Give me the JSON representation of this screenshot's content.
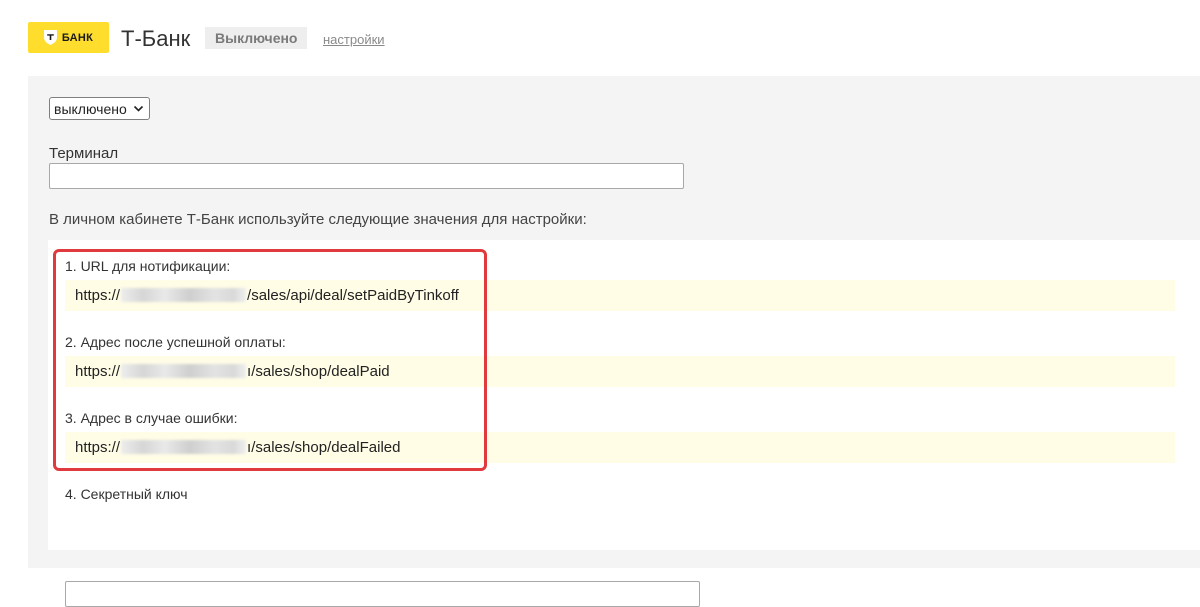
{
  "header": {
    "logo_text": "БАНК",
    "logo_color": "#ffdd2d",
    "app_title": "Т-Банк",
    "status_badge": "Выключено",
    "settings_link": "настройки"
  },
  "form": {
    "mode_select": {
      "selected": "выключено"
    },
    "terminal": {
      "label": "Терминал",
      "value": ""
    },
    "info_text": "В личном кабинете Т-Банк используйте следующие значения для настройки:",
    "items": [
      {
        "label": "1. URL для нотификации:",
        "value_prefix": "https://",
        "value_suffix": "/sales/api/deal/setPaidByTinkoff"
      },
      {
        "label": "2. Адрес после успешной оплаты:",
        "value_prefix": "https://",
        "value_suffix": "ı/sales/shop/dealPaid"
      },
      {
        "label": "3. Адрес в случае ошибки:",
        "value_prefix": "https://",
        "value_suffix": "ı/sales/shop/dealFailed"
      }
    ],
    "secret_key": {
      "label": "4. Секретный ключ",
      "value": ""
    },
    "highlight_color": "#e03a3e"
  }
}
